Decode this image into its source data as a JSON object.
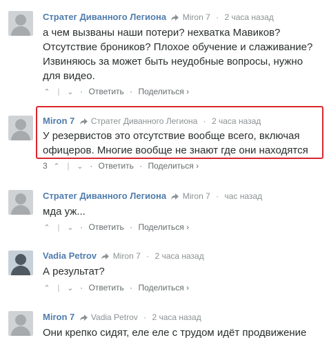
{
  "comments": [
    {
      "author": "Стратег Диванного Легиона",
      "reply_to": "Miron 7",
      "time": "2 часа назад",
      "text": "а чем вызваны наши потери? нехватка Мавиков? Отсутствие броников? Плохое обучение и слаживание? Извиняюсь за может быть неудобные вопросы, нужно для видео.",
      "votes": "",
      "reply_label": "Ответить",
      "share_label": "Поделиться ›"
    },
    {
      "author": "Miron 7",
      "reply_to": "Стратег Диванного Легиона",
      "time": "2 часа назад",
      "text": "У резервистов это отсутствие вообще всего, включая офицеров. Многие вообще не знают где они находятся",
      "votes": "3",
      "reply_label": "Ответить",
      "share_label": "Поделиться ›"
    },
    {
      "author": "Стратег Диванного Легиона",
      "reply_to": "Miron 7",
      "time": "час назад",
      "text": "мда уж...",
      "votes": "",
      "reply_label": "Ответить",
      "share_label": "Поделиться ›"
    },
    {
      "author": "Vadia Petrov",
      "reply_to": "Miron 7",
      "time": "2 часа назад",
      "text": "А результат?",
      "votes": "",
      "reply_label": "Ответить",
      "share_label": "Поделиться ›"
    },
    {
      "author": "Miron 7",
      "reply_to": "Vadia Petrov",
      "time": "2 часа назад",
      "text": "Они крепко сидят, еле еле с трудом идёт продвижение",
      "votes": "",
      "reply_label": "",
      "share_label": ""
    }
  ],
  "icons": {
    "reply_arrow": "share-arrow-icon",
    "upvote": "chevron-up-icon",
    "downvote": "chevron-down-icon",
    "avatar": "default-avatar-icon"
  },
  "colors": {
    "author": "#4f7cac",
    "highlight_border": "#d9252b",
    "meta": "#8b9193"
  }
}
